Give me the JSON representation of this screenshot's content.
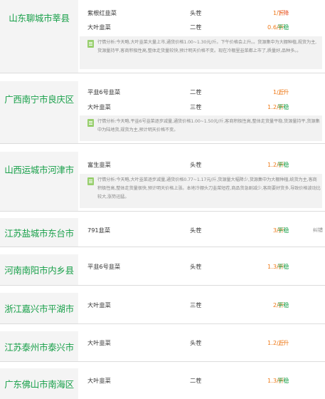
{
  "markets": [
    {
      "region": "山东聊城市莘县",
      "rows": [
        {
          "name": "紫根红韭菜",
          "grade": "头茬",
          "price": "1/斤",
          "trend": "下降",
          "trend_type": "down"
        },
        {
          "name": "大叶韭菜",
          "grade": "二茬",
          "price": "0.6/斤",
          "trend": "平稳",
          "trend_type": "flat"
        }
      ],
      "analysis": "行情分析:今天略,大叶韭菜大量上市,通货价格1.00~1.30元/斤。下午价格会上升。。货源集中为大棚种植,规货为主,货源量持平,客商积极性高,整体走货量较快,预计明天价格不变。现在冷棚里韭菜都上市了,质量好,品种多。。"
    },
    {
      "region": "广西南宁市良庆区",
      "rows": [
        {
          "name": "平韭6号韭菜",
          "grade": "二茬",
          "price": "1/斤",
          "trend": "上升",
          "trend_type": "up"
        },
        {
          "name": "大叶韭菜",
          "grade": "三茬",
          "price": "1.2/斤",
          "trend": "平稳",
          "trend_type": "flat"
        }
      ],
      "analysis": "行情分析:今天略,平韭6号韭菜逐步减量,通货价格1.00~1.50元/斤,客商积极性高,整体走货量平稳,货源量持平,货源集中为陆地货,规货为主,预计明天价格不变。"
    },
    {
      "region": "山西运城市河津市",
      "rows": [
        {
          "name": "富生韭菜",
          "grade": "头茬",
          "price": "1.2/斤",
          "trend": "平稳",
          "trend_type": "flat"
        }
      ],
      "analysis": "行情分析:今天略,大叶韭菜逐步减量,通货价格0.77~1.17元/斤,货源量大幅降少,货源集中为大棚种植,统货为主,客商积极性高,整体走货量很快,预计明天价格上涨。本地冷棚头刀韭菜短茬,商品货急剧减少,客商要好货多,导致价格波动比较大,涨势迅猛。"
    },
    {
      "region": "江苏盐城市东台市",
      "rows": [
        {
          "name": "791韭菜",
          "grade": "头茬",
          "price": "3/斤",
          "trend": "平稳",
          "trend_type": "flat",
          "extra": "纠错"
        }
      ]
    },
    {
      "region": "河南南阳市内乡县",
      "rows": [
        {
          "name": "平韭6号韭菜",
          "grade": "头茬",
          "price": "1.3/斤",
          "trend": "平稳",
          "trend_type": "flat"
        }
      ]
    },
    {
      "region": "浙江嘉兴市平湖市",
      "rows": [
        {
          "name": "大叶韭菜",
          "grade": "三茬",
          "price": "2/斤",
          "trend": "平稳",
          "trend_type": "flat"
        }
      ]
    },
    {
      "region": "江苏泰州市泰兴市",
      "rows": [
        {
          "name": "大叶韭菜",
          "grade": "头茬",
          "price": "1.2/斤",
          "trend": "上升",
          "trend_type": "up"
        }
      ]
    },
    {
      "region": "广东佛山市南海区",
      "rows": [
        {
          "name": "大叶韭菜",
          "grade": "二茬",
          "price": "1.3/斤",
          "trend": "平稳",
          "trend_type": "flat"
        }
      ]
    }
  ]
}
